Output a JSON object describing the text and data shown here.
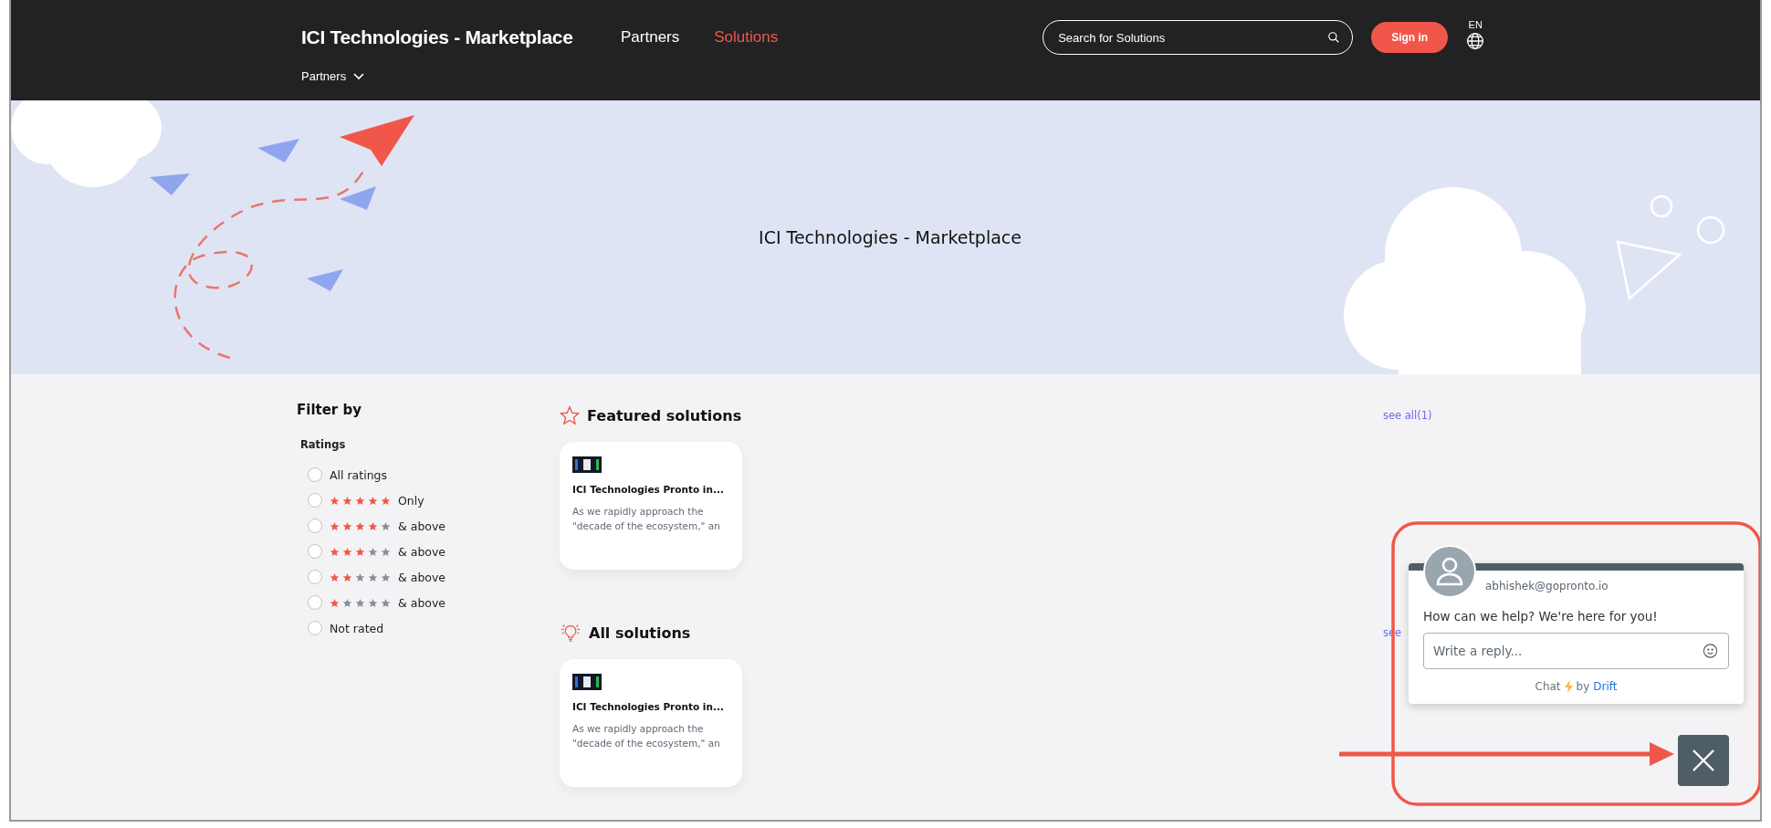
{
  "header": {
    "brand": "ICI Technologies - Marketplace",
    "nav": [
      {
        "label": "Partners",
        "selected": false
      },
      {
        "label": "Solutions",
        "selected": true
      }
    ],
    "search": {
      "placeholder": "Search for Solutions"
    },
    "sign_in": "Sign in",
    "language": "EN",
    "subnav": "Partners"
  },
  "hero": {
    "title": "ICI Technologies - Marketplace"
  },
  "filter": {
    "title": "Filter by",
    "section": "Ratings",
    "options": [
      {
        "kind": "text",
        "label": "All ratings",
        "selected": false
      },
      {
        "kind": "stars",
        "stars": 5,
        "label": "Only",
        "selected": false
      },
      {
        "kind": "stars",
        "stars": 4,
        "label": "& above",
        "selected": false
      },
      {
        "kind": "stars",
        "stars": 3,
        "label": "& above",
        "selected": false
      },
      {
        "kind": "stars",
        "stars": 2,
        "label": "& above",
        "selected": false
      },
      {
        "kind": "stars",
        "stars": 1,
        "label": "& above",
        "selected": false
      },
      {
        "kind": "text",
        "label": "Not rated",
        "selected": false
      }
    ]
  },
  "sections": [
    {
      "kind": "featured",
      "title": "Featured solutions",
      "link": "see all(1)",
      "cards": [
        {
          "title": "ICI Technologies Pronto in...",
          "description": "As we rapidly approach the \"decade of the ecosystem,\" an"
        }
      ]
    },
    {
      "kind": "all",
      "title": "All solutions",
      "link": "see",
      "cards": [
        {
          "title": "ICI Technologies Pronto in...",
          "description": "As we rapidly approach the \"decade of the ecosystem,\" an"
        }
      ]
    }
  ],
  "chat": {
    "agent": "abhishek@gopronto.io",
    "message": "How can we help? We're here for you!",
    "reply_placeholder": "Write a reply...",
    "footer_prefix": "Chat",
    "footer_by": "by",
    "footer_brand": "Drift"
  }
}
